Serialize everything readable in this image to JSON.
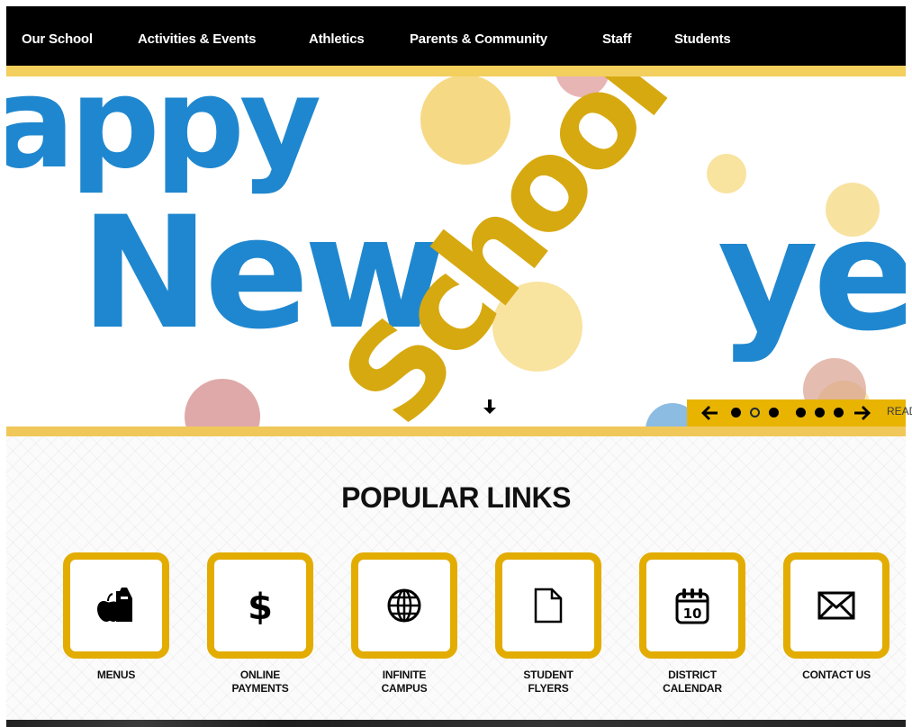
{
  "nav": {
    "items": [
      {
        "label": "Our School"
      },
      {
        "label": "Activities & Events"
      },
      {
        "label": "Athletics"
      },
      {
        "label": "Parents & Community"
      },
      {
        "label": "Staff"
      },
      {
        "label": "Students"
      }
    ]
  },
  "hero": {
    "image_text": {
      "line1": "appy",
      "line2": "New",
      "word_school": "School",
      "word_year": "ye"
    },
    "slider": {
      "prev_icon": "arrow-left-icon",
      "next_icon": "arrow-right-icon",
      "dot_count": 6,
      "active_dot_index": 1,
      "read_more_label": "READ"
    },
    "scroll_down_icon": "arrow-down-icon"
  },
  "popular_links": {
    "title": "POPULAR LINKS",
    "tiles": [
      {
        "label": "MENUS",
        "icon": "lunch-bag-apple-icon"
      },
      {
        "label": "ONLINE\nPAYMENTS",
        "icon": "dollar-icon"
      },
      {
        "label": "INFINITE\nCAMPUS",
        "icon": "globe-icon"
      },
      {
        "label": "STUDENT\nFLYERS",
        "icon": "document-icon"
      },
      {
        "label": "DISTRICT\nCALENDAR",
        "icon": "calendar-icon",
        "calendar_number": "10"
      },
      {
        "label": "CONTACT US",
        "icon": "envelope-icon"
      }
    ]
  },
  "colors": {
    "accent_gold": "#e3ac00",
    "hero_blue": "#1f87cf",
    "hero_gold": "#d6a911",
    "nav_bg": "#000000"
  }
}
